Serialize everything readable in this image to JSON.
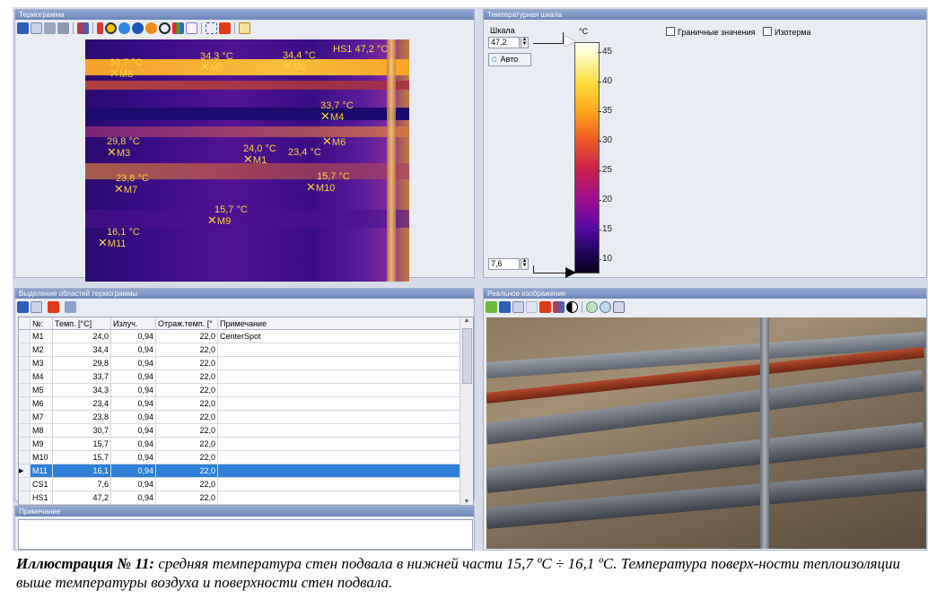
{
  "thermogram": {
    "title": "Термограмма",
    "markers": [
      {
        "temp": "30,7 °C",
        "label": "M8"
      },
      {
        "temp": "34,3 °C",
        "label": "M5"
      },
      {
        "temp": "34,4 °C",
        "label": "M2"
      },
      {
        "temp": "HS1 47,2 °C",
        "label": ""
      },
      {
        "temp": "33,7 °C",
        "label": "M4"
      },
      {
        "temp": "29,8 °C",
        "label": "M3"
      },
      {
        "temp": "24,0 °C",
        "label": "M1"
      },
      {
        "temp": "23,4 °C",
        "label": "M6"
      },
      {
        "temp": "23,8 °C",
        "label": "M7"
      },
      {
        "temp": "15,7 °C",
        "label": "M10"
      },
      {
        "temp": "15,7 °C",
        "label": "M9"
      },
      {
        "temp": "16,1 °C",
        "label": "M11"
      }
    ]
  },
  "scale": {
    "title": "Температурная шкала",
    "label": "Шкала",
    "unit": "°C",
    "max_value": "47,2",
    "min_value": "7,6",
    "auto_button": "Авто",
    "boundary_label": "Граничные значения",
    "isotherm_label": "Изотерма",
    "ticks": [
      "45",
      "40",
      "35",
      "30",
      "25",
      "20",
      "15",
      "10"
    ]
  },
  "regions": {
    "title": "Выделение областей термограммы",
    "columns": [
      "№:",
      "Темп. [°C]",
      "Излуч.",
      "Отраж.темп. [°",
      "Примечание"
    ],
    "rows": [
      [
        "M1",
        "24,0",
        "0,94",
        "22,0",
        "CenterSpot"
      ],
      [
        "M2",
        "34,4",
        "0,94",
        "22,0",
        ""
      ],
      [
        "M3",
        "29,8",
        "0,94",
        "22,0",
        ""
      ],
      [
        "M4",
        "33,7",
        "0,94",
        "22,0",
        ""
      ],
      [
        "M5",
        "34,3",
        "0,94",
        "22,0",
        ""
      ],
      [
        "M6",
        "23,4",
        "0,94",
        "22,0",
        ""
      ],
      [
        "M7",
        "23,8",
        "0,94",
        "22,0",
        ""
      ],
      [
        "M8",
        "30,7",
        "0,94",
        "22,0",
        ""
      ],
      [
        "M9",
        "15,7",
        "0,94",
        "22,0",
        ""
      ],
      [
        "M10",
        "15,7",
        "0,94",
        "22,0",
        ""
      ],
      [
        "M11",
        "16,1",
        "0,94",
        "22,0",
        ""
      ],
      [
        "CS1",
        "7,6",
        "0,94",
        "22,0",
        ""
      ],
      [
        "HS1",
        "47,2",
        "0,94",
        "22,0",
        ""
      ]
    ],
    "selected_row": "M11"
  },
  "note": {
    "title": "Примечание"
  },
  "real_image": {
    "title": "Реальное изображение"
  },
  "caption": {
    "bold": "Иллюстрация № 11:",
    "text": " средняя температура стен подвала в нижней части 15,7 ºС ÷ 16,1 ºС. Температура поверх-ности теплоизоляции выше температуры воздуха и поверхности стен подвала."
  },
  "colors": {
    "accent": "#2f7fd6",
    "marker": "#ffd23a",
    "panel": "#e9ecf3"
  }
}
